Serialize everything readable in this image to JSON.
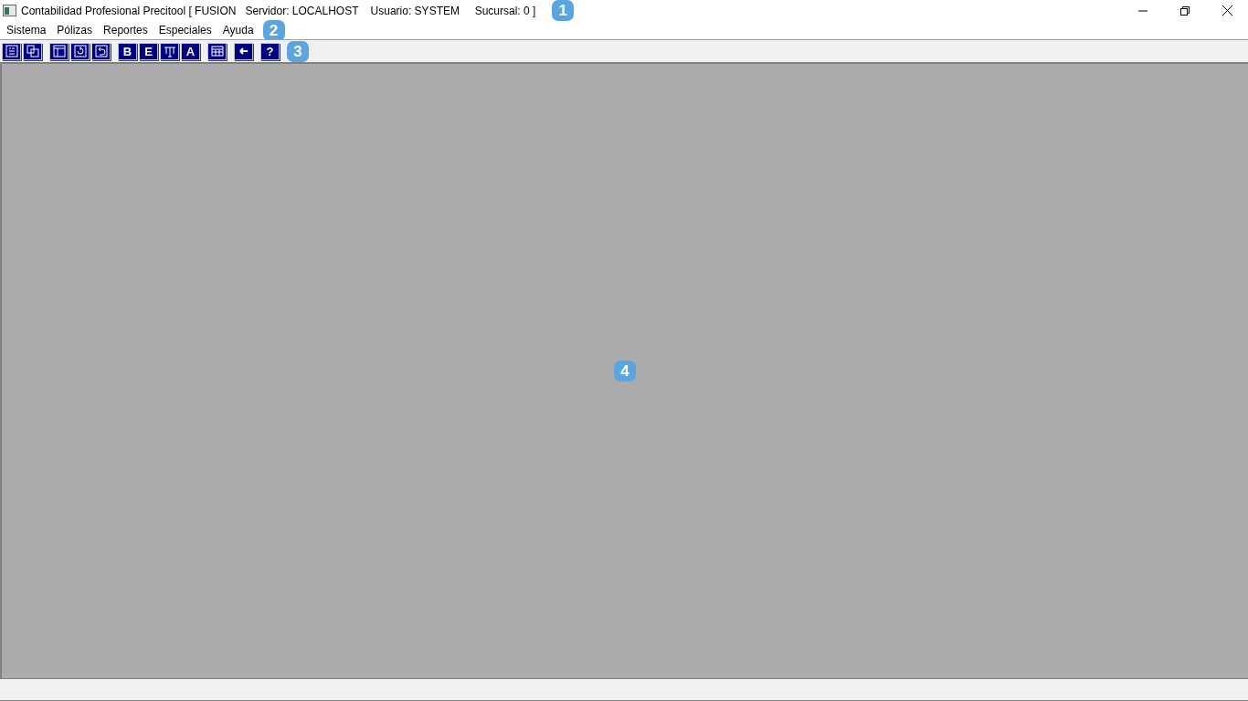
{
  "window": {
    "title": "Contabilidad Profesional Precitool [ FUSION   Servidor: LOCALHOST    Usuario: SYSTEM     Sucursal: 0 ]"
  },
  "menu": [
    "Sistema",
    "Pólizas",
    "Reportes",
    "Especiales",
    "Ayuda"
  ],
  "toolbar": [
    [
      {
        "kind": "icon"
      },
      {
        "kind": "icon"
      }
    ],
    [
      {
        "kind": "icon"
      },
      {
        "kind": "icon"
      },
      {
        "kind": "icon"
      }
    ],
    [
      {
        "kind": "glyph",
        "glyph": "B"
      },
      {
        "kind": "glyph",
        "glyph": "E"
      },
      {
        "kind": "icon"
      },
      {
        "kind": "glyph",
        "glyph": "A"
      }
    ],
    [
      {
        "kind": "icon"
      }
    ],
    [
      {
        "kind": "icon"
      }
    ],
    [
      {
        "kind": "glyph",
        "glyph": "?"
      }
    ]
  ],
  "callouts": [
    "1",
    "2",
    "3",
    "4"
  ]
}
